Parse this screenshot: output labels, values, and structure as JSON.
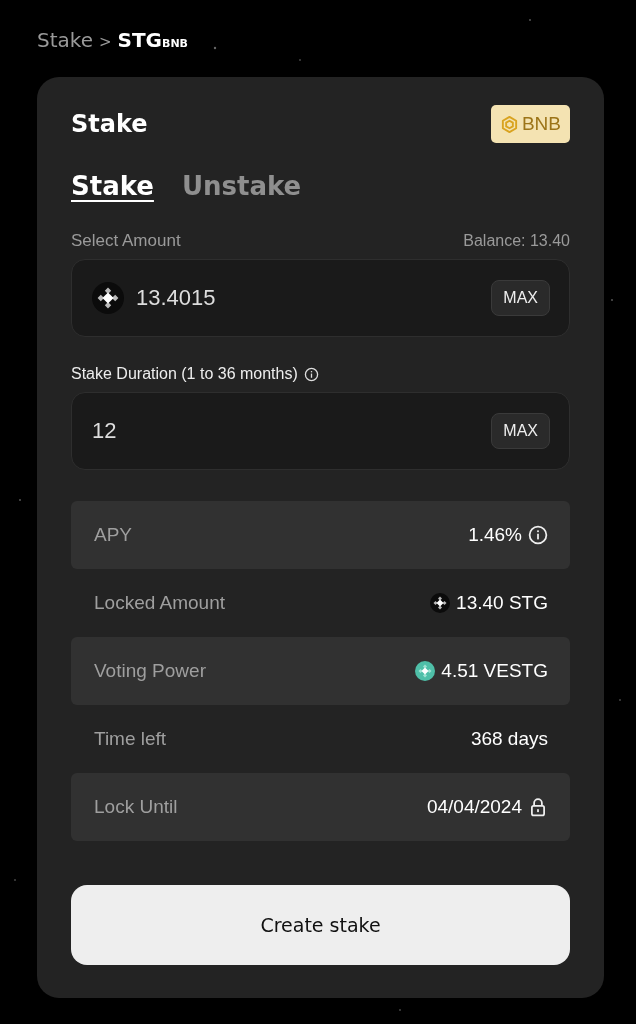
{
  "breadcrumb": {
    "items": [
      "Stake",
      "STG$_{BNB}$"
    ],
    "separator": ">"
  },
  "card": {
    "title": "Stake",
    "network_badge": "BNB",
    "tabs": [
      {
        "label": "Stake",
        "selected": true
      },
      {
        "label": "Unstake",
        "selected": false
      }
    ],
    "amount": {
      "label": "Select Amount",
      "balance": "Balance: 13.40",
      "value": "13.4015",
      "max_button": "MAX"
    },
    "duration": {
      "label": "Stake Duration (1 to 36 months)",
      "value": "12",
      "max_button": "MAX"
    },
    "stats": [
      {
        "label": "APY",
        "value": "1.46%",
        "kind": "info",
        "shaded": true
      },
      {
        "label": "Locked Amount",
        "value": "13.40 STG",
        "kind": "stg",
        "shaded": false
      },
      {
        "label": "Voting Power",
        "value": "4.51 VESTG",
        "kind": "vestg",
        "shaded": true
      },
      {
        "label": "Time left",
        "value": "368 days",
        "kind": "plain",
        "shaded": false
      },
      {
        "label": "Lock Until",
        "value": "04/04/2024",
        "kind": "lock",
        "shaded": true
      }
    ],
    "submit_button": "Create stake"
  }
}
